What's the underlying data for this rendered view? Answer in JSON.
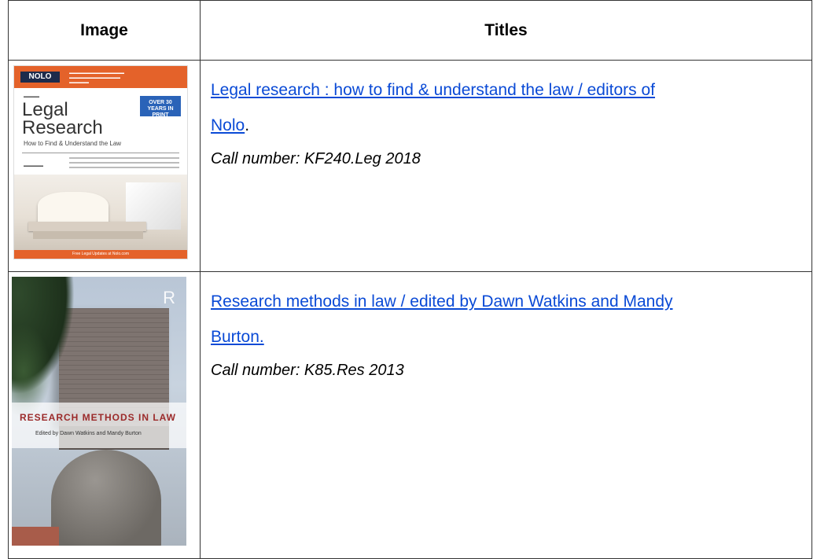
{
  "table": {
    "headers": [
      "Image",
      "Titles"
    ],
    "rows": [
      {
        "title_link_line1": "Legal research : how to find & understand the law / editors of",
        "title_link_line2": "Nolo",
        "title_tail": ".",
        "call_number": "Call number: KF240.Leg 2018",
        "cover": {
          "logo": "NOLO",
          "badge": "OVER 30 YEARS IN PRINT",
          "title_line1": "Legal",
          "title_line2": "Research",
          "subtitle": "How to Find & Understand the Law",
          "bottom_banner": "Free Legal Updates at Nolo.com",
          "brand_color": "#e4622a"
        }
      },
      {
        "title_link_line1": "Research methods in law / edited by Dawn Watkins and Mandy",
        "title_link_line2": "Burton.",
        "title_tail": "",
        "call_number": "Call number: K85.Res 2013",
        "cover": {
          "publisher_mark": "R",
          "title": "RESEARCH METHODS IN LAW",
          "editors": "Edited by Dawn Watkins and Mandy Burton",
          "title_color": "#9b2a2a"
        }
      }
    ]
  },
  "colors": {
    "link": "#0a4ad6",
    "border": "#333333"
  }
}
